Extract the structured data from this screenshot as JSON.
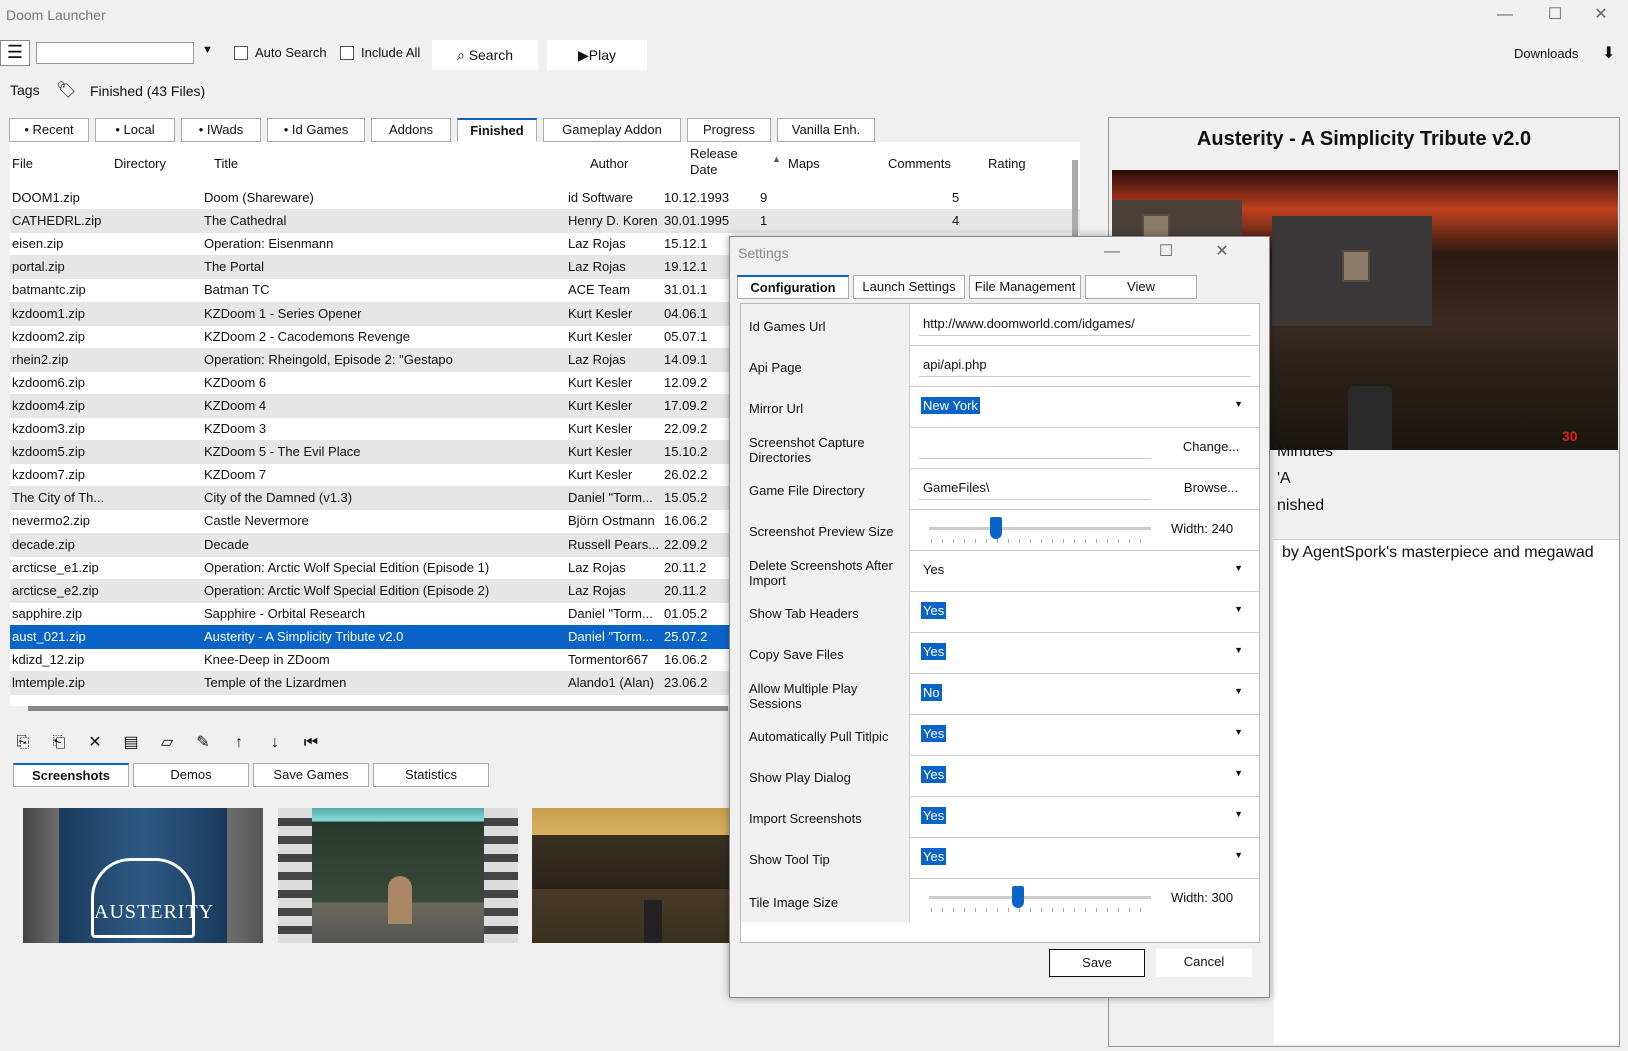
{
  "app": {
    "title": "Doom Launcher"
  },
  "toolbar": {
    "search_value": "",
    "auto_search": "Auto Search",
    "include_all": "Include All",
    "search_button": "Search",
    "play_button": "Play",
    "downloads": "Downloads"
  },
  "tags": {
    "label": "Tags",
    "current": "Finished (43 Files)"
  },
  "tabs": [
    "• Recent",
    "• Local",
    "• IWads",
    "• Id Games",
    "Addons",
    "Finished",
    "Gameplay Addon",
    "Progress",
    "Vanilla Enh."
  ],
  "grid": {
    "headers": [
      "File",
      "Directory",
      "Title",
      "Author",
      "Release Date",
      "Maps",
      "Comments",
      "Rating"
    ],
    "header_release_line1": "Release",
    "header_release_line2": "Date",
    "rows": [
      [
        "DOOM1.zip",
        "",
        "Doom (Shareware)",
        "id Software",
        "10.12.1993",
        "9",
        "",
        "5"
      ],
      [
        "CATHEDRL.zip",
        "",
        "The Cathedral",
        "Henry D. Koren",
        "30.01.1995",
        "1",
        "",
        "4"
      ],
      [
        "eisen.zip",
        "",
        "Operation: Eisenmann",
        "Laz Rojas",
        "15.12.1",
        "",
        "",
        ""
      ],
      [
        "portal.zip",
        "",
        "The Portal",
        "Laz Rojas",
        "19.12.1",
        "",
        "",
        ""
      ],
      [
        "batmantc.zip",
        "",
        "Batman TC",
        "ACE Team",
        "31.01.1",
        "",
        "",
        ""
      ],
      [
        "kzdoom1.zip",
        "",
        "KZDoom 1 - Series Opener",
        "Kurt Kesler",
        "04.06.1",
        "",
        "",
        ""
      ],
      [
        "kzdoom2.zip",
        "",
        "KZDoom 2 - Cacodemons Revenge",
        "Kurt Kesler",
        "05.07.1",
        "",
        "",
        ""
      ],
      [
        "rhein2.zip",
        "",
        "Operation: Rheingold, Episode 2: \"Gestapo",
        "Laz Rojas",
        "14.09.1",
        "",
        "",
        ""
      ],
      [
        "kzdoom6.zip",
        "",
        "KZDoom 6",
        "Kurt Kesler",
        "12.09.2",
        "",
        "",
        ""
      ],
      [
        "kzdoom4.zip",
        "",
        "KZDoom 4",
        "Kurt Kesler",
        "17.09.2",
        "",
        "",
        ""
      ],
      [
        "kzdoom3.zip",
        "",
        "KZDoom 3",
        "Kurt Kesler",
        "22.09.2",
        "",
        "",
        ""
      ],
      [
        "kzdoom5.zip",
        "",
        "KZDoom 5 - The Evil Place",
        "Kurt Kesler",
        "15.10.2",
        "",
        "",
        ""
      ],
      [
        "kzdoom7.zip",
        "",
        "KZDoom 7",
        "Kurt Kesler",
        "26.02.2",
        "",
        "",
        ""
      ],
      [
        "The City of Th...",
        "",
        "City of the Damned (v1.3)",
        "Daniel \"Torm...",
        "15.05.2",
        "",
        "",
        ""
      ],
      [
        "nevermo2.zip",
        "",
        "Castle Nevermore",
        "Björn Ostmann",
        "16.06.2",
        "",
        "",
        ""
      ],
      [
        "decade.zip",
        "",
        "Decade",
        "Russell Pears...",
        "22.09.2",
        "",
        "",
        ""
      ],
      [
        "arcticse_e1.zip",
        "",
        "Operation: Arctic Wolf Special Edition (Episode 1)",
        "Laz Rojas",
        "20.11.2",
        "",
        "",
        ""
      ],
      [
        "arcticse_e2.zip",
        "",
        "Operation: Arctic Wolf Special Edition (Episode 2)",
        "Laz Rojas",
        "20.11.2",
        "",
        "",
        ""
      ],
      [
        "sapphire.zip",
        "",
        "Sapphire - Orbital Research",
        "Daniel \"Torm...",
        "01.05.2",
        "",
        "",
        ""
      ],
      [
        "aust_021.zip",
        "",
        "Austerity - A Simplicity Tribute v2.0",
        "Daniel \"Torm...",
        "25.07.2",
        "",
        "",
        ""
      ],
      [
        "kdizd_12.zip",
        "",
        "Knee-Deep in ZDoom",
        "Tormentor667",
        "16.06.2",
        "",
        "",
        ""
      ],
      [
        "lmtemple.zip",
        "",
        "Temple of the Lizardmen",
        "Alando1 (Alan)",
        "23.06.2",
        "",
        "",
        ""
      ]
    ],
    "selected_index": 19
  },
  "bottom_tabs": [
    "Screenshots",
    "Demos",
    "Save Games",
    "Statistics"
  ],
  "thumbnails": {
    "logo_text": "AUSTERITY"
  },
  "right_panel": {
    "title": "Austerity - A Simplicity Tribute v2.0",
    "field1": "Minutes",
    "field2": "'A",
    "field3": "nished",
    "description": "by AgentSpork's masterpiece and megawad",
    "ammo": "30"
  },
  "dialog": {
    "title": "Settings",
    "tabs": [
      "Configuration",
      "Launch Settings",
      "File Management",
      "View"
    ],
    "rows": {
      "id_games_url": {
        "label": "Id Games Url",
        "value": "http://www.doomworld.com/idgames/"
      },
      "api_page": {
        "label": "Api Page",
        "value": "api/api.php"
      },
      "mirror_url": {
        "label": "Mirror Url",
        "value": "New York"
      },
      "screenshot_capture": {
        "label": "Screenshot Capture Directories",
        "value": "",
        "button": "Change..."
      },
      "game_file_dir": {
        "label": "Game File Directory",
        "value": "GameFiles\\",
        "button": "Browse..."
      },
      "preview_size": {
        "label": "Screenshot Preview Size",
        "value": "Width: 240",
        "level": 0.3
      },
      "delete_after_import": {
        "label": "Delete Screenshots After Import",
        "value": "Yes"
      },
      "show_tab_headers": {
        "label": "Show Tab Headers",
        "value": "Yes"
      },
      "copy_save_files": {
        "label": "Copy Save Files",
        "value": "Yes"
      },
      "allow_multiple": {
        "label": "Allow Multiple Play Sessions",
        "value": "No"
      },
      "auto_titlpic": {
        "label": "Automatically Pull Titlpic",
        "value": "Yes"
      },
      "show_play_dialog": {
        "label": "Show Play Dialog",
        "value": "Yes"
      },
      "import_screenshots": {
        "label": "Import Screenshots",
        "value": "Yes"
      },
      "show_tool_tip": {
        "label": "Show Tool Tip",
        "value": "Yes"
      },
      "tile_image_size": {
        "label": "Tile Image Size",
        "value": "Width: 300",
        "level": 0.4
      }
    },
    "save": "Save",
    "cancel": "Cancel"
  },
  "colors": {
    "accent": "#0a64c8",
    "selection": "#0a64c8"
  }
}
